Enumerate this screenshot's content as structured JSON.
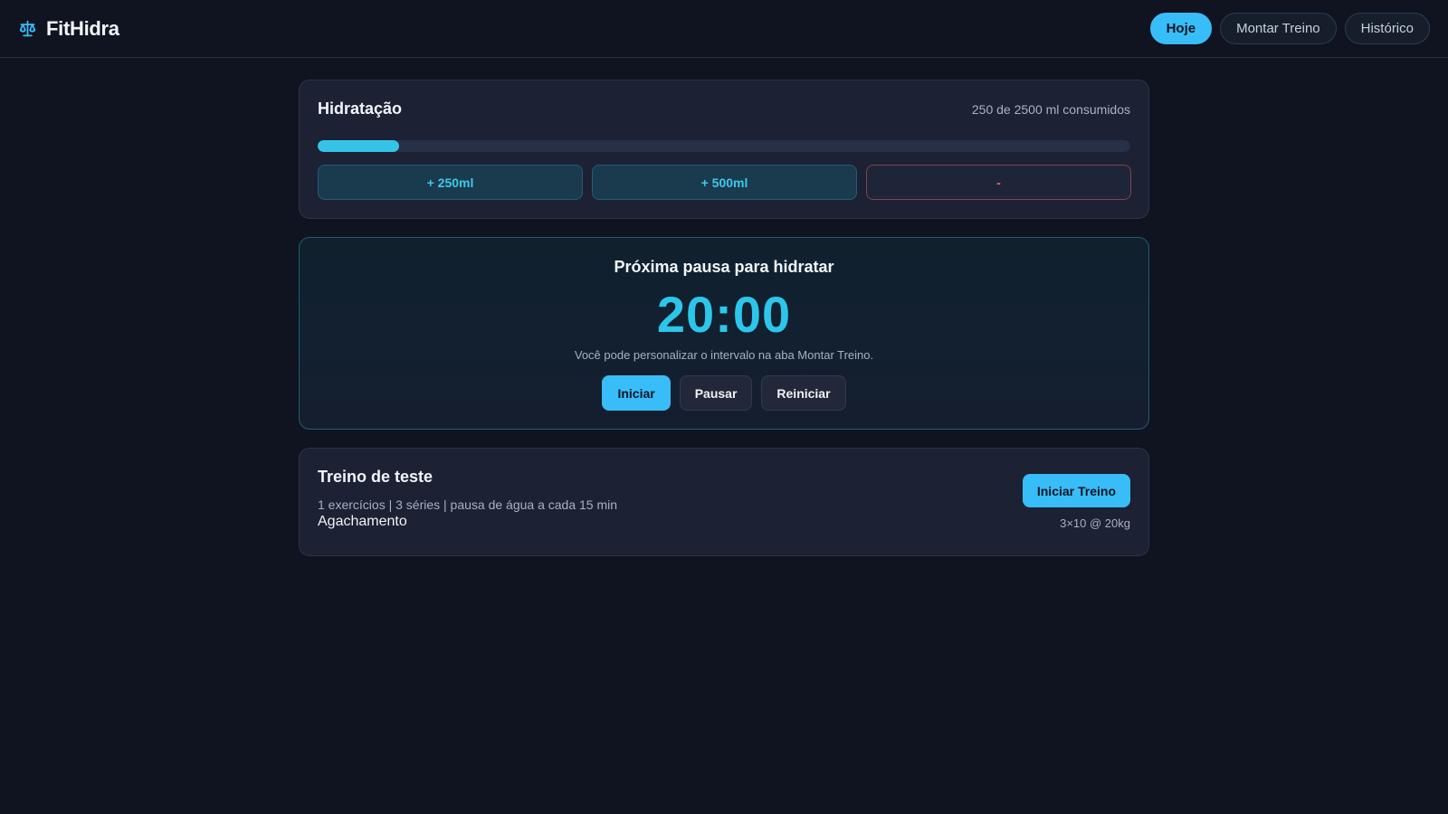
{
  "brand": {
    "name": "FitHidra",
    "icon": "scale-icon",
    "accent": "#38bdf8"
  },
  "nav": {
    "items": [
      {
        "label": "Hoje",
        "active": true
      },
      {
        "label": "Montar Treino",
        "active": false
      },
      {
        "label": "Histórico",
        "active": false
      }
    ]
  },
  "hydration": {
    "title": "Hidratação",
    "status": "250 de 2500 ml consumidos",
    "consumed_ml": 250,
    "goal_ml": 2500,
    "progress_fraction": 0.1,
    "buttons": {
      "add_250": "+ 250ml",
      "add_500": "+ 500ml",
      "remove": "-"
    }
  },
  "timer": {
    "title": "Próxima pausa para hidratar",
    "value": "20:00",
    "hint": "Você pode personalizar o intervalo na aba Montar Treino.",
    "buttons": {
      "start": "Iniciar",
      "pause": "Pausar",
      "reset": "Reiniciar"
    }
  },
  "workout": {
    "title": "Treino de teste",
    "meta": "1 exercícios | 3 séries | pausa de água a cada 15 min",
    "exercise": "Agachamento",
    "start_label": "Iniciar Treino",
    "detail": "3×10 @ 20kg"
  }
}
